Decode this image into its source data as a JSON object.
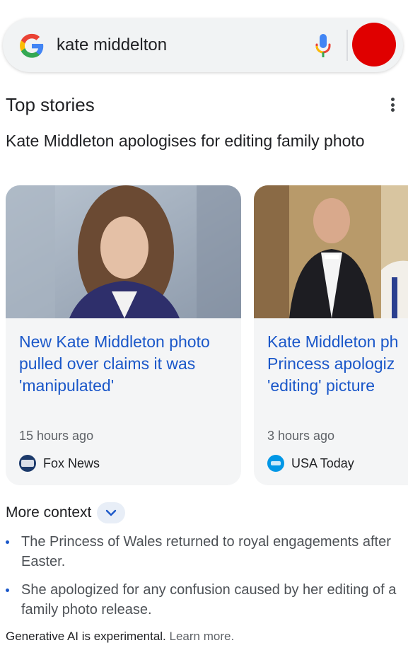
{
  "search": {
    "query": "kate middelton"
  },
  "top_stories": {
    "title": "Top stories",
    "headline": "Kate Middleton apologises for editing family photo",
    "cards": [
      {
        "title": "New Kate Middleton photo pulled over claims it was 'manipulated'",
        "time": "15 hours ago",
        "source": "Fox News"
      },
      {
        "title": "Kate Middleton ph\nPrincess apologiz\n'editing' picture",
        "time": "3 hours ago",
        "source": "USA Today"
      }
    ]
  },
  "more_context": {
    "label": "More context",
    "bullets": [
      "The Princess of Wales returned to royal engagements after Easter.",
      "She apologized for any confusion caused by her editing of a family photo release."
    ]
  },
  "footer": {
    "disclaimer": "Generative AI is experimental.",
    "learn_more": "Learn more."
  },
  "colors": {
    "link_blue": "#1a57c9",
    "avatar_red": "#e00000"
  }
}
